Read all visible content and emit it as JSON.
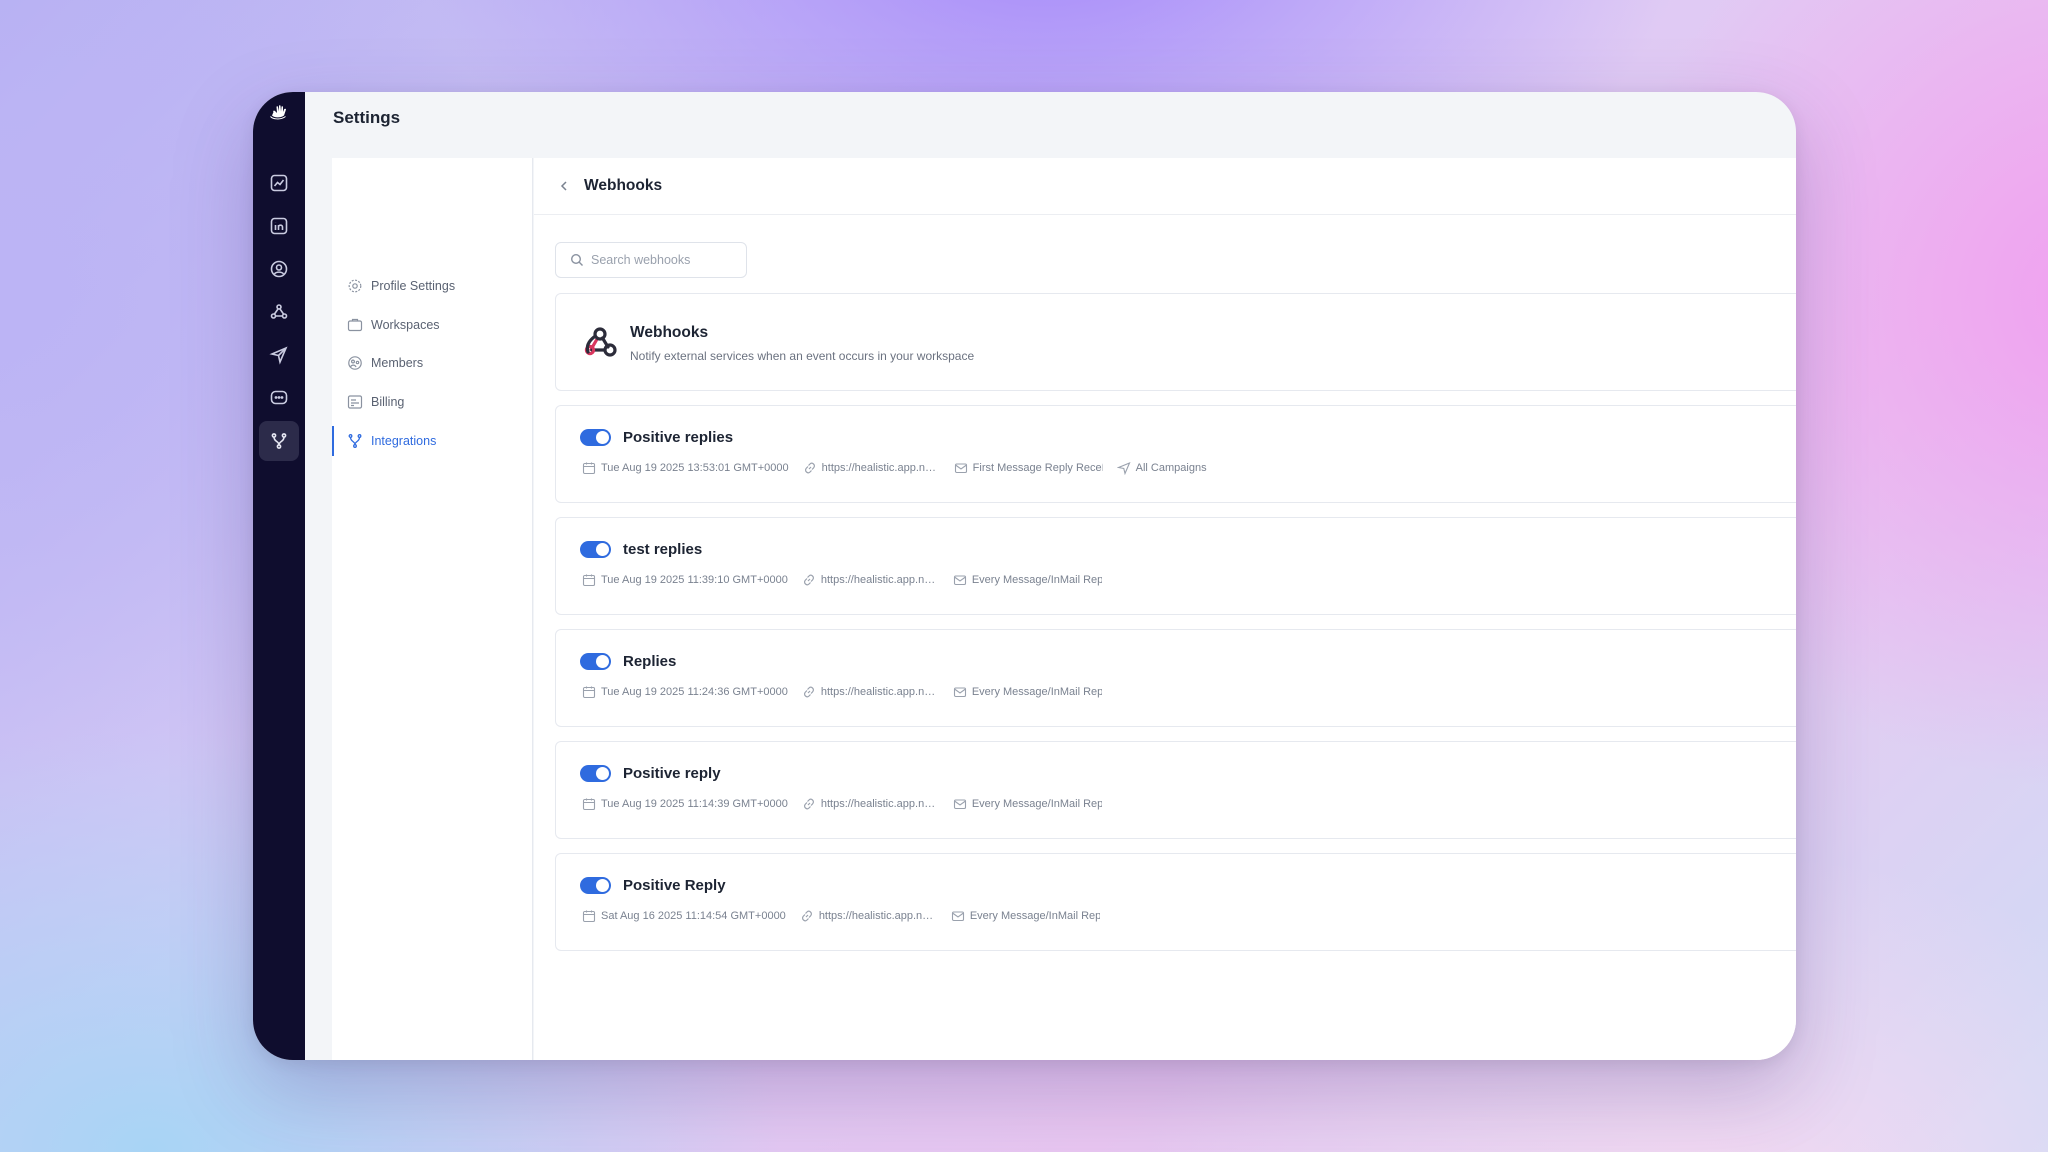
{
  "page": {
    "title": "Settings"
  },
  "settings_nav": {
    "items": [
      {
        "label": "Profile Settings",
        "icon": "gear-icon"
      },
      {
        "label": "Workspaces",
        "icon": "briefcase-icon"
      },
      {
        "label": "Members",
        "icon": "team-icon"
      },
      {
        "label": "Billing",
        "icon": "billing-icon"
      },
      {
        "label": "Integrations",
        "icon": "integrations-icon",
        "active": true
      }
    ]
  },
  "content": {
    "header": {
      "title": "Webhooks"
    },
    "search": {
      "placeholder": "Search webhooks"
    },
    "intro": {
      "title": "Webhooks",
      "description": "Notify external services when an event occurs in your workspace"
    },
    "webhooks": [
      {
        "name": "Positive replies",
        "enabled": true,
        "date": "Tue Aug 19 2025 13:53:01 GMT+0000",
        "url": "https://healistic.app.n8...",
        "trigger": "First Message Reply Receí",
        "scope": "All Campaigns"
      },
      {
        "name": "test replies",
        "enabled": true,
        "date": "Tue Aug 19 2025 11:39:10 GMT+0000",
        "url": "https://healistic.app.n8...",
        "trigger": "Every Message/InMail Repl"
      },
      {
        "name": "Replies",
        "enabled": true,
        "date": "Tue Aug 19 2025 11:24:36 GMT+0000",
        "url": "https://healistic.app.n8...",
        "trigger": "Every Message/InMail Repl"
      },
      {
        "name": "Positive reply",
        "enabled": true,
        "date": "Tue Aug 19 2025 11:14:39 GMT+0000",
        "url": "https://healistic.app.n8...",
        "trigger": "Every Message/InMail Repl"
      },
      {
        "name": "Positive Reply",
        "enabled": true,
        "date": "Sat Aug 16 2025 11:14:54 GMT+0000",
        "url": "https://healistic.app.n8...",
        "trigger": "Every Message/InMail Repl"
      }
    ]
  },
  "colors": {
    "accent": "#2f6bdf",
    "rail": "#0f0d2e",
    "webhook_logo": "#d9365e"
  }
}
